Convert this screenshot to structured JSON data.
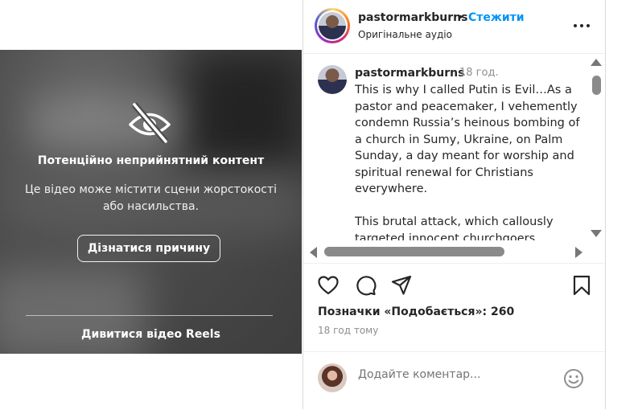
{
  "video": {
    "warning_icon": "eye-slash-icon",
    "warning_title": "Потенційно неприйнятний контент",
    "warning_description": "Це відео може містити сцени жорстокості або насильства.",
    "reason_button": "Дізнатися причину",
    "watch_reels": "Дивитися відео Reels"
  },
  "header": {
    "username": "pastormarkburns",
    "separator": "•",
    "follow_label": "Стежити",
    "audio_label": "Оригінальне аудіо",
    "more_icon": "more-horizontal-icon"
  },
  "caption": {
    "username": "pastormarkburns",
    "time": "18 год.",
    "text": "This is why I called Putin is Evil…As a pastor and peacemaker, I vehemently condemn Russia’s heinous bombing of a church in Sumy, Ukraine, on Palm Sunday, a day meant for worship and spiritual renewal for Christians everywhere.\n\nThis brutal attack, which callously targeted innocent churchgoers"
  },
  "actions": {
    "icons": [
      "heart-icon",
      "comment-icon",
      "share-icon",
      "bookmark-icon"
    ],
    "likes_text": "Позначки «Подобається»: 260",
    "time_ago": "18 год тому"
  },
  "comment": {
    "placeholder": "Додайте коментар...",
    "emoji_icon": "emoji-icon"
  },
  "colors": {
    "accent": "#0095f6",
    "secondary_text": "#8e8e8e",
    "overlay_bg": "#4c4c4c"
  }
}
